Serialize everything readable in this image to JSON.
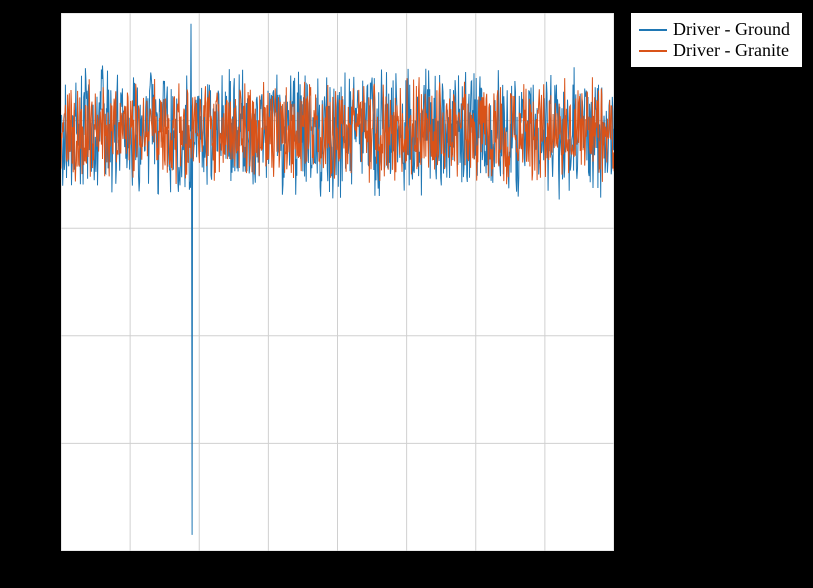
{
  "chart_data": {
    "type": "line",
    "xlim": [
      0,
      1000
    ],
    "ylim": [
      -0.78,
      0.22
    ],
    "x_grid": [
      0,
      125,
      250,
      375,
      500,
      625,
      750,
      875,
      1000
    ],
    "y_grid": [
      -0.78,
      -0.58,
      -0.38,
      -0.18,
      0.02,
      0.22
    ],
    "series": [
      {
        "name": "Driver - Ground",
        "color": "#1f77b4",
        "n": 1000,
        "mean": 0.0,
        "noise_amp": 0.1,
        "spikes": [
          {
            "x": 235,
            "y": 0.2
          },
          {
            "x": 237,
            "y": -0.75
          }
        ]
      },
      {
        "name": "Driver - Granite",
        "color": "#d95319",
        "n": 1000,
        "mean": 0.0,
        "noise_amp": 0.08,
        "spikes": []
      }
    ],
    "xlabel": "",
    "ylabel": "",
    "title": ""
  },
  "legend": {
    "items": [
      {
        "label": "Driver - Ground",
        "color": "#1f77b4"
      },
      {
        "label": "Driver - Granite",
        "color": "#d95319"
      }
    ]
  }
}
